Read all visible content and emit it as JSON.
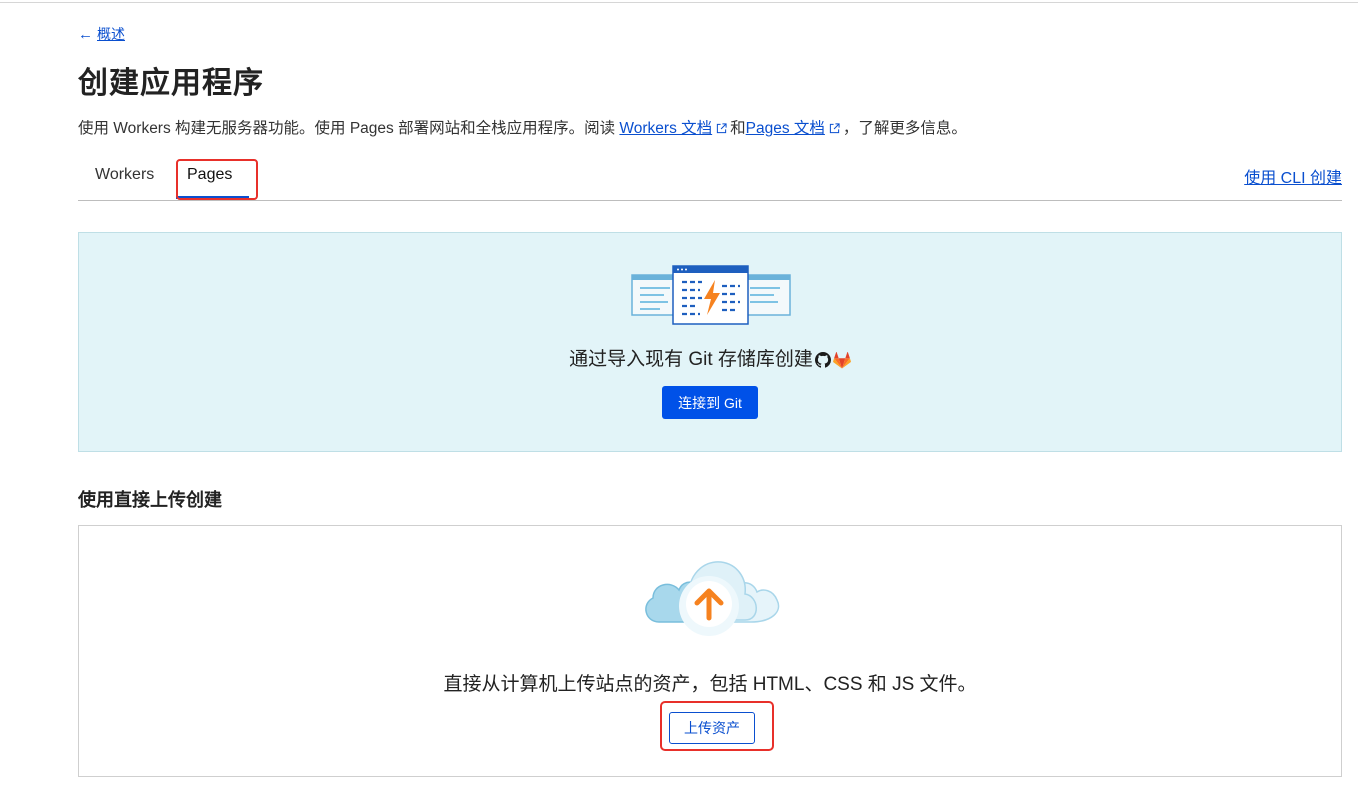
{
  "breadcrumb": {
    "arrow": "←",
    "label": "概述"
  },
  "page": {
    "title": "创建应用程序"
  },
  "description": {
    "prefix": "使用 Workers 构建无服务器功能。使用 Pages 部署网站和全栈应用程序。阅读 ",
    "workers_docs_link": "Workers 文档",
    "and": "和",
    "pages_docs_link": "Pages 文档",
    "suffix": "，了解更多信息。"
  },
  "tabs": [
    {
      "label": "Workers",
      "active": false
    },
    {
      "label": "Pages",
      "active": true
    }
  ],
  "cli_link": "使用 CLI 创建",
  "git_section": {
    "text": "通过导入现有 Git 存储库创建",
    "icons": [
      "github-icon",
      "gitlab-icon"
    ],
    "button": "连接到 Git"
  },
  "direct_upload": {
    "title": "使用直接上传创建",
    "text": "直接从计算机上传站点的资产，包括 HTML、CSS 和 JS 文件。",
    "button": "上传资产"
  },
  "colors": {
    "primary": "#0051e8",
    "link": "#0a4fcf",
    "panel_bg": "#e2f4f8",
    "highlight": "#e8302a",
    "accent_orange": "#f6821f"
  }
}
